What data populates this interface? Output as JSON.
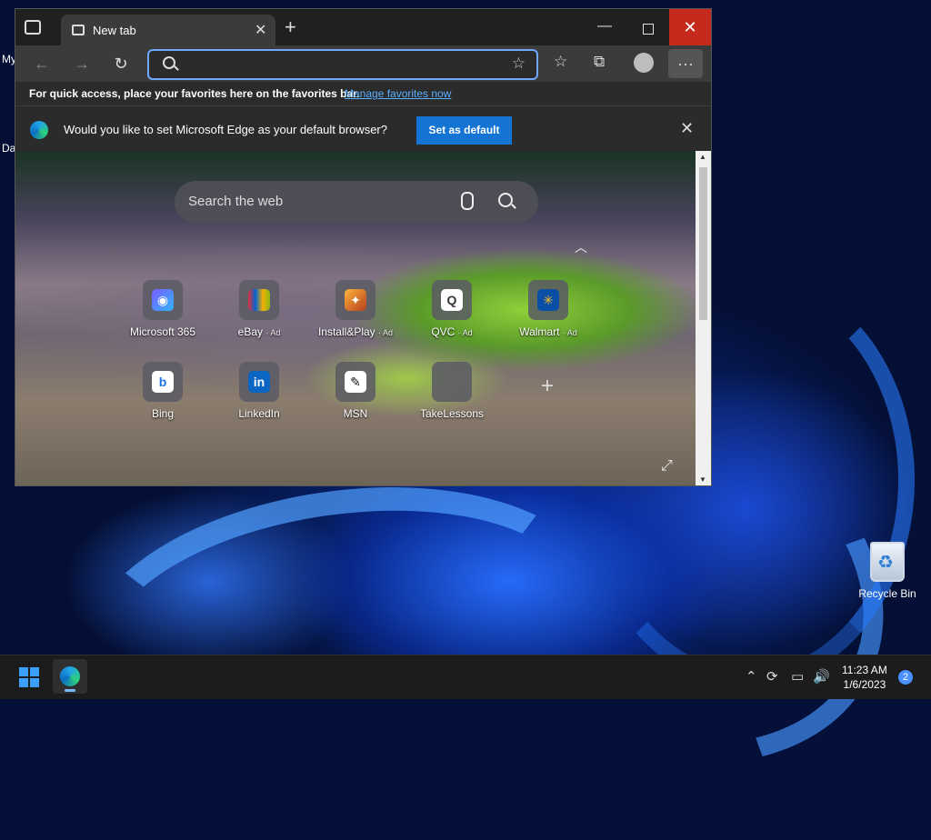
{
  "desktop": {
    "left_label_1": "My",
    "left_label_2": "Da",
    "recycle_bin_label": "Recycle Bin"
  },
  "browser": {
    "tab_title": "New tab",
    "new_tab_symbol": "+",
    "window_min": "—",
    "window_close": "✕",
    "favorites_bar_text": "For quick access, place your favorites here on the favorites bar.",
    "favorites_link": "Manage favorites now",
    "infobar_text": "Would you like to set Microsoft Edge as your default browser?",
    "set_default_button": "Set as default",
    "infobar_close": "✕",
    "more_menu": "···",
    "colors": {
      "accent": "#1474d4",
      "close": "#c42b1c",
      "link": "#5ab1ff"
    }
  },
  "new_tab_page": {
    "search_placeholder": "Search the web",
    "tiles_row1": [
      {
        "label": "Microsoft 365",
        "ad": ""
      },
      {
        "label": "eBay",
        "ad": "· Ad"
      },
      {
        "label": "Install&Play",
        "ad": "· Ad"
      },
      {
        "label": "QVC",
        "ad": "· Ad"
      },
      {
        "label": "Walmart",
        "ad": "· Ad"
      }
    ],
    "tiles_row2": [
      {
        "label": "Bing"
      },
      {
        "label": "LinkedIn"
      },
      {
        "label": "MSN"
      },
      {
        "label": "TakeLessons"
      }
    ],
    "add_tile_symbol": "+"
  },
  "taskbar": {
    "time": "11:23 AM",
    "date": "1/6/2023",
    "notification_count": "2"
  }
}
